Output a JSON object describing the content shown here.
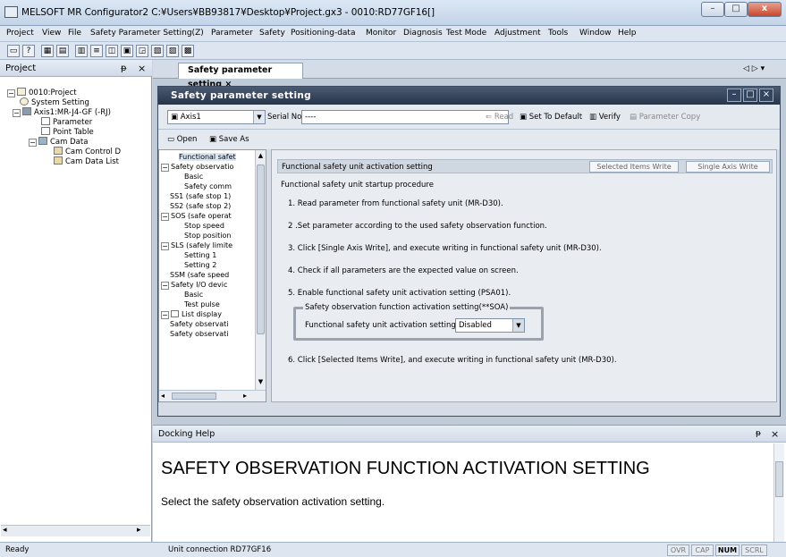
{
  "window": {
    "title": "MELSOFT MR Configurator2 C:¥Users¥BB93817¥Desktop¥Project.gx3 - 0010:RD77GF16[]",
    "min": "–",
    "max": "□",
    "close": "x"
  },
  "menu": [
    "Project",
    "View",
    "File",
    "Safety Parameter Setting(Z)",
    "Parameter",
    "Safety",
    "Positioning-data",
    "Monitor",
    "Diagnosis",
    "Test Mode",
    "Adjustment",
    "Tools",
    "Window",
    "Help"
  ],
  "project_pane": {
    "title": "Project",
    "pin": "ᵽ",
    "close": "×",
    "tree": [
      "0010:Project",
      "System Setting",
      "Axis1:MR-J4-GF (-RJ)",
      "Parameter",
      "Point Table",
      "Cam Data",
      "Cam Control D",
      "Cam Data List"
    ]
  },
  "doc_tab": {
    "label": "Safety parameter setting",
    "close": "×",
    "nav": "◁ ▷ ▾"
  },
  "safety_window": {
    "title": "Safety parameter setting",
    "axis": "Axis1",
    "serial_label": "Serial No.",
    "serial_value": "----",
    "buttons": {
      "read": "Read",
      "set_default": "Set To Default",
      "verify": "Verify",
      "param_copy": "Parameter Copy",
      "open": "Open",
      "save_as": "Save As"
    },
    "tree": [
      "Functional safet",
      "Safety observatio",
      "Basic",
      "Safety comm",
      "SS1 (safe stop 1)",
      "SS2 (safe stop 2)",
      "SOS (safe operat",
      "Stop speed",
      "Stop position",
      "SLS (safely limite",
      "Setting 1",
      "Setting 2",
      "SSM (safe speed",
      "Safety I/O devic",
      "Basic",
      "Test pulse",
      "List display",
      "Safety observati",
      "Safety observati"
    ],
    "panel": {
      "header": "Functional safety unit activation setting",
      "btn_selected": "Selected Items Write",
      "btn_single": "Single Axis Write",
      "procedure_title": "Functional safety unit startup procedure",
      "steps": [
        "1. Read parameter from functional safety unit (MR-D30).",
        "2 .Set parameter according to the used safety observation function.",
        "3. Click [Single Axis Write], and execute writing in functional safety unit (MR-D30).",
        "4. Check if all parameters are the expected value on screen.",
        "5. Enable functional safety unit activation setting (PSA01).",
        "6. Click [Selected Items Write], and execute writing in functional safety unit (MR-D30)."
      ],
      "group_legend": "Safety observation function activation setting(**SOA)",
      "field_label": "Functional safety unit activation setting",
      "field_value": "Disabled"
    }
  },
  "help": {
    "pane_title": "Docking Help",
    "pin": "ᵽ",
    "close": "×",
    "heading": "SAFETY OBSERVATION FUNCTION ACTIVATION SETTING",
    "text": "Select the safety observation activation setting."
  },
  "status": {
    "left": "Ready",
    "connection": "Unit connection RD77GF16",
    "ovr": "OVR",
    "cap": "CAP",
    "num": "NUM",
    "scrl": "SCRL"
  }
}
